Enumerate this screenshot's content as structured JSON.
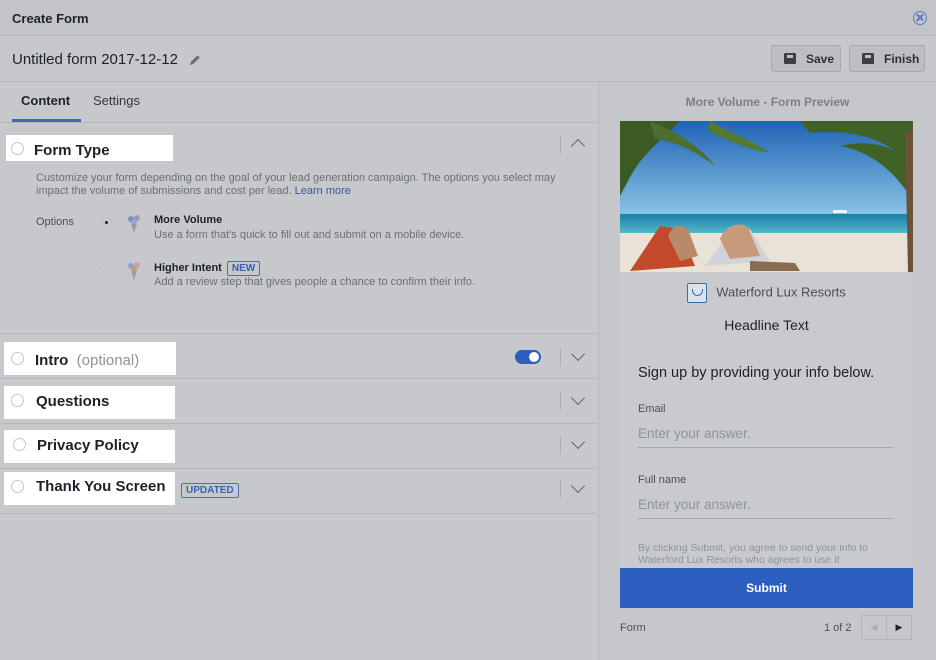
{
  "window": {
    "title": "Create Form"
  },
  "header": {
    "form_name": "Untitled form 2017-12-12",
    "save_label": "Save",
    "finish_label": "Finish"
  },
  "tabs": [
    {
      "label": "Content",
      "active": true
    },
    {
      "label": "Settings",
      "active": false
    }
  ],
  "sections": {
    "form_type": {
      "title": "Form Type",
      "description": "Customize your form depending on the goal of your lead generation campaign. The options you select may impact the volume of submissions and cost per lead.",
      "learn_more": "Learn more",
      "options_label": "Options",
      "options": [
        {
          "title": "More Volume",
          "subtitle": "Use a form that's quick to fill out and submit on a mobile device.",
          "selected": true,
          "badge": ""
        },
        {
          "title": "Higher Intent",
          "subtitle": "Add a review step that gives people a chance to confirm their info.",
          "selected": false,
          "badge": "NEW"
        }
      ]
    },
    "intro": {
      "title": "Intro",
      "optional": "(optional)",
      "enabled": true
    },
    "questions": {
      "title": "Questions"
    },
    "privacy": {
      "title": "Privacy Policy"
    },
    "thank_you": {
      "title": "Thank You Screen",
      "badge": "UPDATED"
    }
  },
  "preview": {
    "title": "More Volume - Form Preview",
    "brand": "Waterford Lux Resorts",
    "headline": "Headline Text",
    "signup_text": "Sign up by providing your info below.",
    "fields": [
      {
        "label": "Email",
        "placeholder": "Enter your answer."
      },
      {
        "label": "Full name",
        "placeholder": "Enter your answer."
      }
    ],
    "disclaimer": "By clicking Submit, you agree to send your info to Waterford Lux Resorts who agrees to use it",
    "submit_label": "Submit",
    "footer_label": "Form",
    "pager": "1 of 2"
  },
  "colors": {
    "accent": "#4267b2",
    "submit": "#2c5fc0",
    "toggle": "#2d5fbd"
  }
}
